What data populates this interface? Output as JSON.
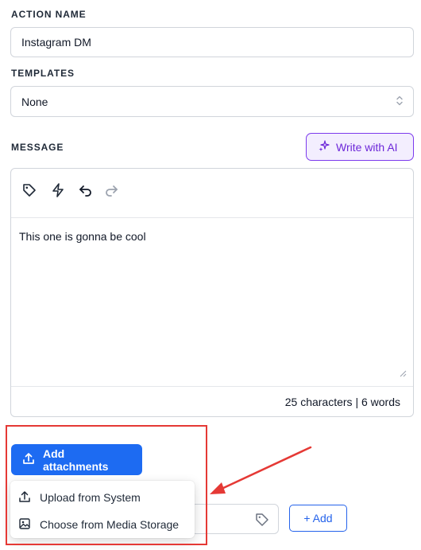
{
  "action_name": {
    "label": "ACTION NAME",
    "value": "Instagram DM"
  },
  "templates": {
    "label": "TEMPLATES",
    "selected": "None"
  },
  "message": {
    "label": "MESSAGE",
    "ai_button_label": "Write with AI",
    "toolbar_icons": [
      "tag-icon",
      "lightning-icon",
      "undo-icon",
      "redo-icon"
    ],
    "text": "This one is gonna be cool",
    "counter": "25 characters | 6 words"
  },
  "attachments": {
    "button_label": "Add attachments",
    "menu_items": [
      {
        "icon": "upload-icon",
        "label": "Upload from System"
      },
      {
        "icon": "image-icon",
        "label": "Choose from Media Storage"
      }
    ]
  },
  "tags": {
    "add_label": "+ Add"
  },
  "colors": {
    "primary": "#1d6bf2",
    "ai_accent": "#7c3aed",
    "annotation_red": "#e53935"
  }
}
